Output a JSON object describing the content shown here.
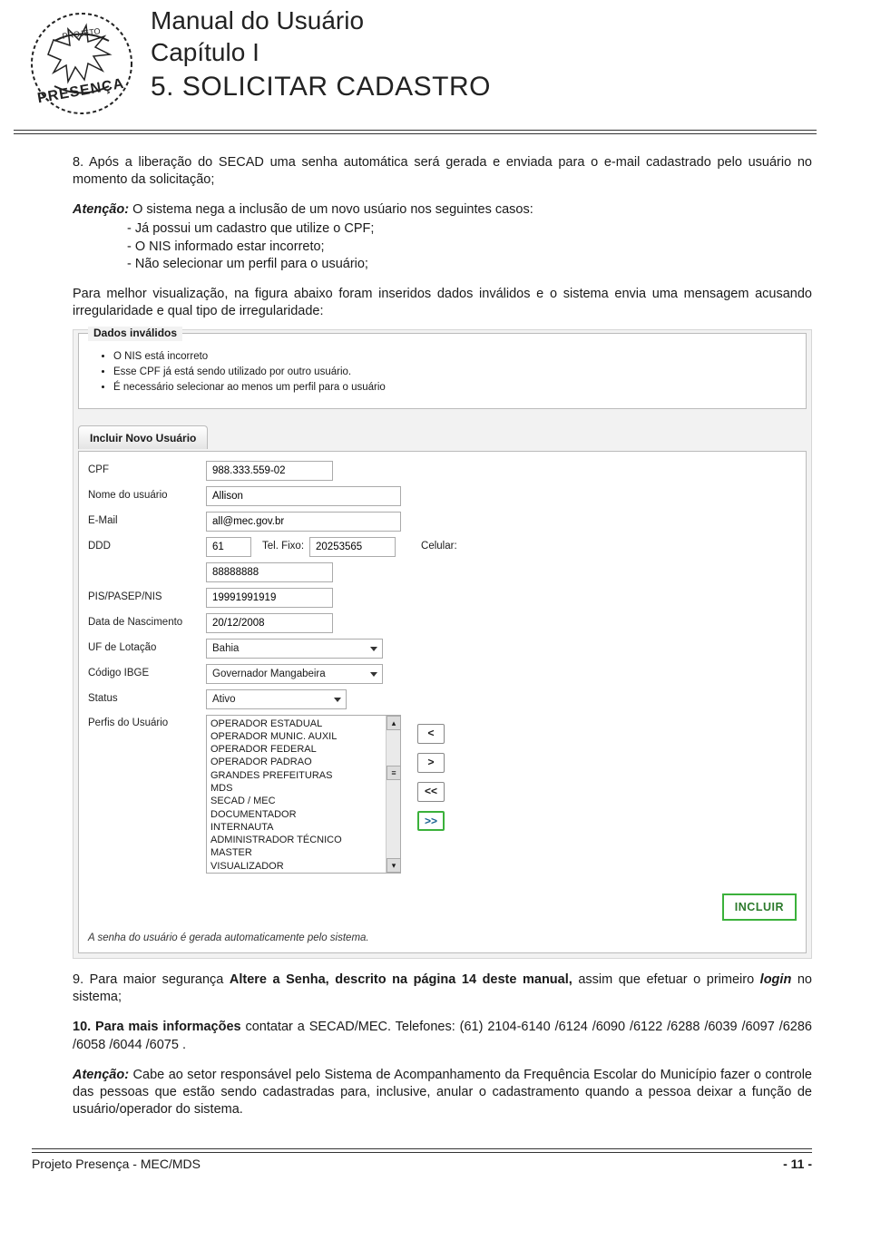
{
  "header": {
    "manual_title": "Manual do Usuário",
    "chapter": "Capítulo I",
    "section": "5. SOLICITAR CADASTRO"
  },
  "body": {
    "p8_intro": "8. Após a liberação do SECAD uma senha automática será gerada e enviada para o e-mail cadastrado pelo usuário no momento da solicitação;",
    "attention_label": "Atenção:",
    "attention_text": " O sistema nega a inclusão de um novo usúario nos seguintes casos:",
    "bullets": [
      "- Já possui um cadastro que utilize o CPF;",
      "- O NIS informado estar incorreto;",
      "- Não selecionar um perfil para o usuário;"
    ],
    "para_figure": "Para melhor visualização, na figura abaixo foram inseridos dados inválidos e o sistema envia uma mensagem acusando irregularidade e qual tipo de irregularidade:",
    "p9_intro": "9.  Para maior segurança ",
    "p9_bold": "Altere a Senha, descrito na página 14 deste manual,",
    "p9_rest1": " assim  que efetuar o primeiro ",
    "p9_login": "login",
    "p9_rest2": " no sistema;",
    "p10_bold": "10. Para mais informações",
    "p10_rest": " contatar a SECAD/MEC. Telefones: (61) 2104-6140 /6124 /6090 /6122 /6288 /6039 /6097 /6286 /6058 /6044 /6075 .",
    "p_attn2_label": "Atenção:",
    "p_attn2_text": " Cabe ao setor responsável pelo Sistema de Acompanhamento da Frequência Escolar do Município fazer o controle das pessoas que estão sendo cadastradas para, inclusive, anular o cadastramento quando a pessoa deixar a função de usuário/operador do sistema."
  },
  "figure": {
    "legend": "Dados inválidos",
    "items": [
      "O NIS está incorreto",
      "Esse CPF já está sendo utilizado por outro usuário.",
      "É necessário selecionar ao menos um perfil para o usuário"
    ],
    "tab": "Incluir Novo Usuário",
    "labels": {
      "cpf": "CPF",
      "nome": "Nome do usuário",
      "email": "E-Mail",
      "ddd": "DDD",
      "telfixo": "Tel. Fixo:",
      "celular": "Celular:",
      "pis": "PIS/PASEP/NIS",
      "data": "Data de Nascimento",
      "uf": "UF de Lotação",
      "ibge": "Código IBGE",
      "status": "Status",
      "perfis": "Perfis do Usuário"
    },
    "values": {
      "cpf": "988.333.559-02",
      "nome": "Allison",
      "email": "all@mec.gov.br",
      "ddd": "61",
      "telfixo": "20253565",
      "celular": "",
      "extra": "88888888",
      "pis": "19991991919",
      "data": "20/12/2008",
      "uf": "Bahia",
      "ibge": "Governador Mangabeira",
      "status": "Ativo"
    },
    "profiles": [
      "OPERADOR ESTADUAL",
      "OPERADOR MUNIC. AUXIL",
      "OPERADOR FEDERAL",
      "OPERADOR PADRAO",
      "GRANDES PREFEITURAS",
      "MDS",
      "SECAD / MEC",
      "DOCUMENTADOR",
      "INTERNAUTA",
      "ADMINISTRADOR TÉCNICO",
      "MASTER",
      "VISUALIZADOR"
    ],
    "move_buttons": [
      "<",
      ">",
      "<<",
      ">>"
    ],
    "incluir": "INCLUIR",
    "note": "A senha do usuário é gerada automaticamente pelo sistema."
  },
  "footer": {
    "left": "Projeto Presença - MEC/MDS",
    "page": "- 11 -"
  }
}
